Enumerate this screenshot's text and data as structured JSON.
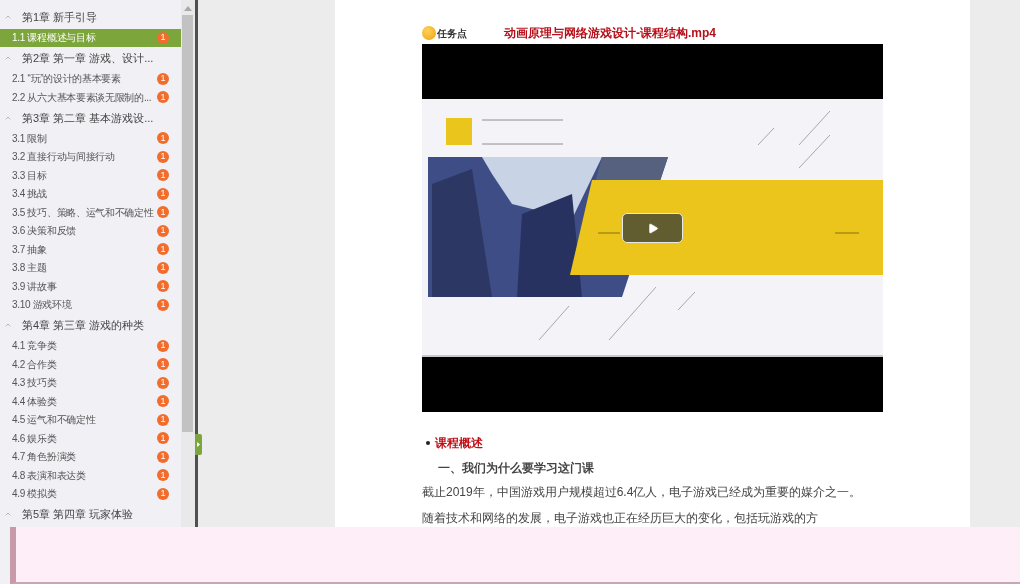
{
  "sidebar": {
    "chapters": [
      {
        "title": "第1章 新手引导",
        "expanded": true,
        "items": [
          {
            "label": "1.1 课程概述与目标",
            "badge": "1",
            "selected": true
          }
        ]
      },
      {
        "title": "第2章 第一章 游戏、设计...",
        "expanded": true,
        "items": [
          {
            "label": "2.1 “玩”的设计的基本要素",
            "badge": "1",
            "selected": false
          },
          {
            "label": "2.2 从六大基本要素谈无限制的...",
            "badge": "1",
            "selected": false
          }
        ]
      },
      {
        "title": "第3章 第二章 基本游戏设...",
        "expanded": true,
        "items": [
          {
            "label": "3.1 限制",
            "badge": "1",
            "selected": false
          },
          {
            "label": "3.2 直接行动与间接行动",
            "badge": "1",
            "selected": false
          },
          {
            "label": "3.3 目标",
            "badge": "1",
            "selected": false
          },
          {
            "label": "3.4 挑战",
            "badge": "1",
            "selected": false
          },
          {
            "label": "3.5 技巧、策略、运气和不确定性",
            "badge": "1",
            "selected": false
          },
          {
            "label": "3.6 决策和反馈",
            "badge": "1",
            "selected": false
          },
          {
            "label": "3.7 抽象",
            "badge": "1",
            "selected": false
          },
          {
            "label": "3.8 主题",
            "badge": "1",
            "selected": false
          },
          {
            "label": "3.9 讲故事",
            "badge": "1",
            "selected": false
          },
          {
            "label": "3.10 游戏环境",
            "badge": "1",
            "selected": false
          }
        ]
      },
      {
        "title": "第4章 第三章 游戏的种类",
        "expanded": true,
        "items": [
          {
            "label": "4.1 竞争类",
            "badge": "1",
            "selected": false
          },
          {
            "label": "4.2 合作类",
            "badge": "1",
            "selected": false
          },
          {
            "label": "4.3 技巧类",
            "badge": "1",
            "selected": false
          },
          {
            "label": "4.4 体验类",
            "badge": "1",
            "selected": false
          },
          {
            "label": "4.5 运气和不确定性",
            "badge": "1",
            "selected": false
          },
          {
            "label": "4.6 娱乐类",
            "badge": "1",
            "selected": false
          },
          {
            "label": "4.7 角色扮演类",
            "badge": "1",
            "selected": false
          },
          {
            "label": "4.8 表演和表达类",
            "badge": "1",
            "selected": false
          },
          {
            "label": "4.9 模拟类",
            "badge": "1",
            "selected": false
          }
        ]
      },
      {
        "title": "第5章 第四章 玩家体验",
        "expanded": true
      }
    ]
  },
  "content": {
    "task_label": "任务点",
    "video_title": "动画原理与网络游戏设计-课程结构.mp4",
    "section_heading": "课程概述",
    "subheading": "一、我们为什么要学习这门课",
    "paragraph_lines": [
      "截止2019年，中国游戏用户规模超过6.4亿人，电子游戏已经成为重要的媒介之一。",
      "随着技术和网络的发展，电子游戏也正在经历巨大的变化，包括玩游戏的方"
    ]
  }
}
